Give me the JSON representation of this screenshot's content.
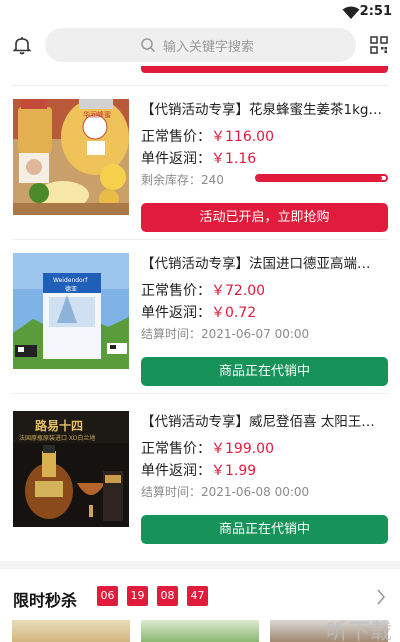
{
  "status_bar": {
    "time": "2:51",
    "wifi_icon": "wifi-icon"
  },
  "search": {
    "placeholder": "输入关键字搜索",
    "icon": "search-icon"
  },
  "header_icons": {
    "left": "bell-icon",
    "right": "scan-icon"
  },
  "colors": {
    "accent_red": "#e11b3b",
    "accent_green": "#17935a",
    "price_red": "#e11b3b"
  },
  "products": [
    {
      "title": "【代销活动专享】花泉蜂蜜生姜茶1kg…",
      "regular_label": "正常售价：",
      "regular_price": "￥116.00",
      "rebate_label": "单件返润：",
      "rebate_price": "￥1.16",
      "meta_label": "剩余库存：",
      "meta_value": "240",
      "stock_progress": 0.97,
      "button": "活动已开启，立即抢购",
      "button_color": "red"
    },
    {
      "title": "【代销活动专享】法国进口德亚高端…",
      "regular_label": "正常售价：",
      "regular_price": "￥72.00",
      "rebate_label": "单件返润：",
      "rebate_price": "￥0.72",
      "meta_label": "结算时间：",
      "meta_value": "2021-06-07 00:00",
      "button": "商品正在代销中",
      "button_color": "green"
    },
    {
      "title": "【代销活动专享】威尼登佰喜 太阳王…",
      "regular_label": "正常售价：",
      "regular_price": "￥199.00",
      "rebate_label": "单件返润：",
      "rebate_price": "￥1.99",
      "meta_label": "结算时间：",
      "meta_value": "2021-06-08 00:00",
      "button": "商品正在代销中",
      "button_color": "green"
    }
  ],
  "flash_sale": {
    "title": "限时秒杀",
    "countdown": [
      "06",
      "19",
      "08",
      "47"
    ],
    "arrow_icon": "chevron-right-icon"
  },
  "image_text": {
    "honey_label": "华润蜂蜜",
    "milk_brand": "Weidendorf",
    "milk_caption": "德亚",
    "wine_title": "路易十四",
    "wine_sub": "法国原瓶原装进口 XO白兰地"
  },
  "watermark": "听下载"
}
